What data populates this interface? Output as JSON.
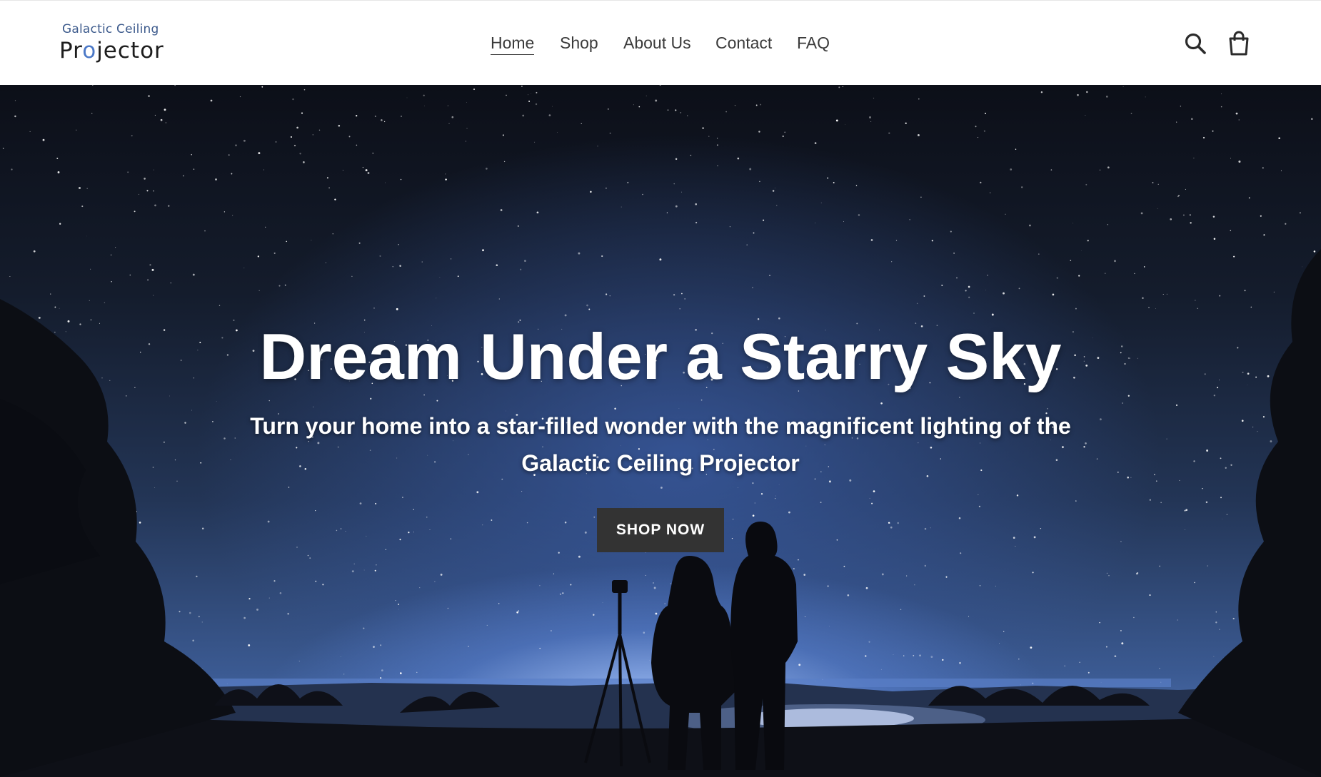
{
  "brand": {
    "logo_top": "Galactic Ceiling",
    "logo_bottom_left": "Pr",
    "logo_bottom_mark": "o",
    "logo_bottom_right": "jector"
  },
  "nav": {
    "items": [
      {
        "label": "Home",
        "active": true
      },
      {
        "label": "Shop",
        "active": false
      },
      {
        "label": "About Us",
        "active": false
      },
      {
        "label": "Contact",
        "active": false
      },
      {
        "label": "FAQ",
        "active": false
      }
    ]
  },
  "header_icons": {
    "search": "search-icon",
    "cart": "cart-icon"
  },
  "hero": {
    "title": "Dream Under a Starry Sky",
    "subtitle": "Turn your home into a star-filled wonder with the magnificent lighting of the Galactic Ceiling Projector",
    "cta_label": "SHOP NOW"
  },
  "colors": {
    "nav_text": "#3a3a3a",
    "button_bg": "#333333",
    "logo_accent": "#4b78c7"
  }
}
